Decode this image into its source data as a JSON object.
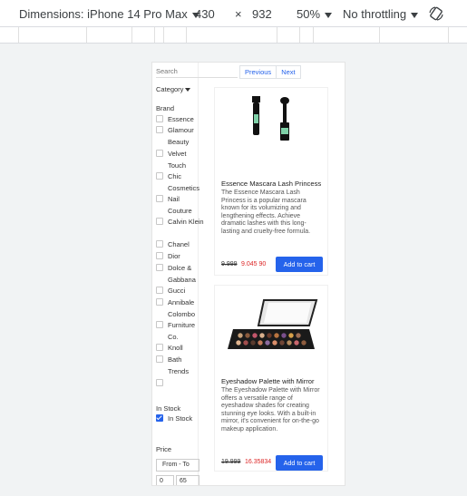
{
  "devtools": {
    "dimensions_label": "Dimensions: iPhone 14 Pro Max",
    "width": "430",
    "times": "×",
    "height": "932",
    "zoom": "50%",
    "throttling": "No throttling"
  },
  "sidebar": {
    "search_placeholder": "Search",
    "category_label": "Category",
    "brand_heading": "Brand",
    "brands": [
      "Essence",
      "Glamour Beauty",
      "Velvet Touch",
      "Chic Cosmetics",
      "Nail Couture",
      "Calvin Klein",
      "Chanel",
      "Dior",
      "Dolce & Gabbana",
      "Gucci",
      "Annibale Colombo",
      "Furniture Co.",
      "Knoll",
      "Bath Trends"
    ],
    "in_stock_heading": "In Stock",
    "in_stock_label": "In Stock",
    "price_heading": "Price",
    "price_from": "From - To",
    "price_min": "0",
    "price_max": "65"
  },
  "pagination": {
    "previous": "Previous",
    "next": "Next"
  },
  "products": [
    {
      "title": "Essence Mascara Lash Princess",
      "description": "The Essence Mascara Lash Princess is a popular mascara known for its volumizing and lengthening effects. Achieve dramatic lashes with this long-lasting and cruelty-free formula.",
      "old_price": "9.999",
      "new_price": "9.045 90",
      "cart_label": "Add to cart"
    },
    {
      "title": "Eyeshadow Palette with Mirror",
      "description": "The Eyeshadow Palette with Mirror offers a versatile range of eyeshadow shades for creating stunning eye looks. With a built-in mirror, it's convenient for on-the-go makeup application.",
      "old_price": "19.999",
      "new_price": "16.35834",
      "cart_label": "Add to cart"
    }
  ],
  "colors": {
    "accent": "#2563eb",
    "sale": "#dc2626"
  }
}
